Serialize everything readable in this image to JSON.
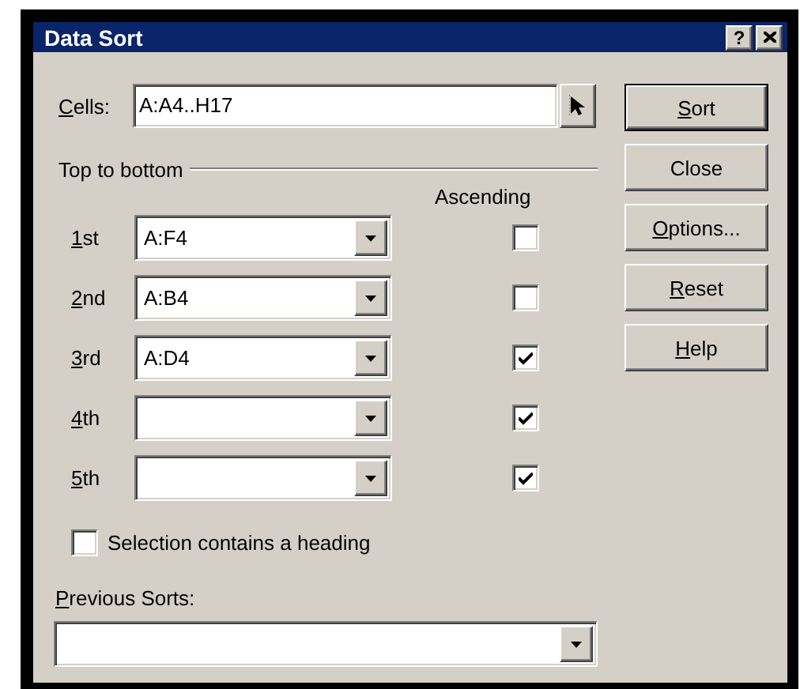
{
  "window": {
    "title": "Data Sort",
    "help_button": "?"
  },
  "cells": {
    "label": "Cells:",
    "mnemonic": true,
    "value": "A:A4..H17"
  },
  "sort_section": {
    "title": "Top to bottom",
    "column_header": "Ascending"
  },
  "keys": [
    {
      "label": "1st",
      "mnemonic": true,
      "value": "A:F4",
      "ascending": false
    },
    {
      "label": "2nd",
      "mnemonic": true,
      "value": "A:B4",
      "ascending": false
    },
    {
      "label": "3rd",
      "mnemonic": true,
      "value": "A:D4",
      "ascending": true
    },
    {
      "label": "4th",
      "mnemonic": true,
      "ascending": true
    },
    {
      "label": "5th",
      "mnemonic": true,
      "ascending": true
    }
  ],
  "heading_checkbox": {
    "label": "Selection contains a heading",
    "checked": false
  },
  "previous_sorts": {
    "label": "Previous Sorts:",
    "mnemonic": true
  },
  "buttons": [
    {
      "label": "Sort",
      "mnemonic": true,
      "default": true
    },
    {
      "label": "Close",
      "mnemonic": false,
      "default": false
    },
    {
      "label": "Options...",
      "mnemonic": true,
      "default": false
    },
    {
      "label": "Reset",
      "mnemonic": true,
      "default": false
    },
    {
      "label": "Help",
      "mnemonic": true,
      "default": false
    }
  ]
}
